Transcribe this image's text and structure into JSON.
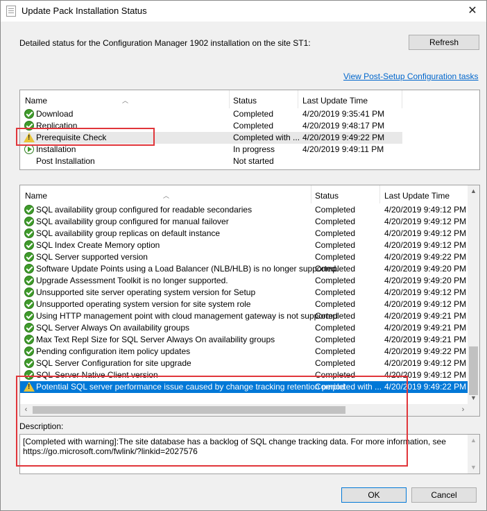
{
  "window": {
    "title": "Update Pack Installation Status",
    "close_glyph": "✕"
  },
  "detail_label": "Detailed status for the Configuration Manager 1902 installation on the site ST1:",
  "refresh_label": "Refresh",
  "post_setup_link": "View Post-Setup Configuration tasks",
  "stages": {
    "columns": [
      "Name",
      "Status",
      "Last Update Time"
    ],
    "rows": [
      {
        "icon": "check-icon",
        "name": "Download",
        "status": "Completed",
        "time": "4/20/2019 9:35:41 PM"
      },
      {
        "icon": "check-icon",
        "name": "Replication",
        "status": "Completed",
        "time": "4/20/2019 9:48:17 PM"
      },
      {
        "icon": "warning-icon",
        "name": "Prerequisite Check",
        "status": "Completed with ...",
        "time": "4/20/2019 9:49:22 PM"
      },
      {
        "icon": "in-progress-icon",
        "name": "Installation",
        "status": "In progress",
        "time": "4/20/2019 9:49:11 PM"
      },
      {
        "icon": "",
        "name": "Post Installation",
        "status": "Not started",
        "time": ""
      }
    ]
  },
  "checks": {
    "columns": [
      "Name",
      "Status",
      "Last Update Time"
    ],
    "rows": [
      {
        "icon": "check-icon",
        "name": "SQL availability group configured for readable secondaries",
        "status": "Completed",
        "time": "4/20/2019 9:49:12 PM"
      },
      {
        "icon": "check-icon",
        "name": "SQL availability group configured for manual failover",
        "status": "Completed",
        "time": "4/20/2019 9:49:12 PM"
      },
      {
        "icon": "check-icon",
        "name": "SQL availability group replicas on default instance",
        "status": "Completed",
        "time": "4/20/2019 9:49:12 PM"
      },
      {
        "icon": "check-icon",
        "name": "SQL Index Create Memory option",
        "status": "Completed",
        "time": "4/20/2019 9:49:12 PM"
      },
      {
        "icon": "check-icon",
        "name": "SQL Server supported version",
        "status": "Completed",
        "time": "4/20/2019 9:49:22 PM"
      },
      {
        "icon": "check-icon",
        "name": "Software Update Points using a Load Balancer (NLB/HLB) is no longer supported.",
        "status": "Completed",
        "time": "4/20/2019 9:49:20 PM"
      },
      {
        "icon": "check-icon",
        "name": "Upgrade Assessment Toolkit is no longer supported.",
        "status": "Completed",
        "time": "4/20/2019 9:49:20 PM"
      },
      {
        "icon": "check-icon",
        "name": "Unsupported site server operating system version for Setup",
        "status": "Completed",
        "time": "4/20/2019 9:49:12 PM"
      },
      {
        "icon": "check-icon",
        "name": "Unsupported operating system version for site system role",
        "status": "Completed",
        "time": "4/20/2019 9:49:12 PM"
      },
      {
        "icon": "check-icon",
        "name": "Using HTTP management point with cloud management gateway is not supported",
        "status": "Completed",
        "time": "4/20/2019 9:49:21 PM"
      },
      {
        "icon": "check-icon",
        "name": "SQL Server Always On availability groups",
        "status": "Completed",
        "time": "4/20/2019 9:49:21 PM"
      },
      {
        "icon": "check-icon",
        "name": "Max Text Repl Size for SQL Server Always On availability groups",
        "status": "Completed",
        "time": "4/20/2019 9:49:21 PM"
      },
      {
        "icon": "check-icon",
        "name": "Pending configuration item policy updates",
        "status": "Completed",
        "time": "4/20/2019 9:49:22 PM"
      },
      {
        "icon": "check-icon",
        "name": "SQL Server Configuration for site upgrade",
        "status": "Completed",
        "time": "4/20/2019 9:49:12 PM"
      },
      {
        "icon": "check-icon",
        "name": "SQL Server Native Client version",
        "status": "Completed",
        "time": "4/20/2019 9:49:12 PM"
      },
      {
        "icon": "warning-icon",
        "name": "Potential SQL server performance issue caused by change tracking retention period",
        "status": "Completed with ...",
        "time": "4/20/2019 9:49:22 PM"
      }
    ]
  },
  "description_label": "Description:",
  "description_text": "[Completed with warning]:The site database has a backlog of SQL change tracking data. For more information, see https://go.microsoft.com/fwlink/?linkid=2027576",
  "ok_label": "OK",
  "cancel_label": "Cancel",
  "colors": {
    "highlight_box": "#e0353a",
    "selection": "#0078d7",
    "link": "#0066cc"
  }
}
